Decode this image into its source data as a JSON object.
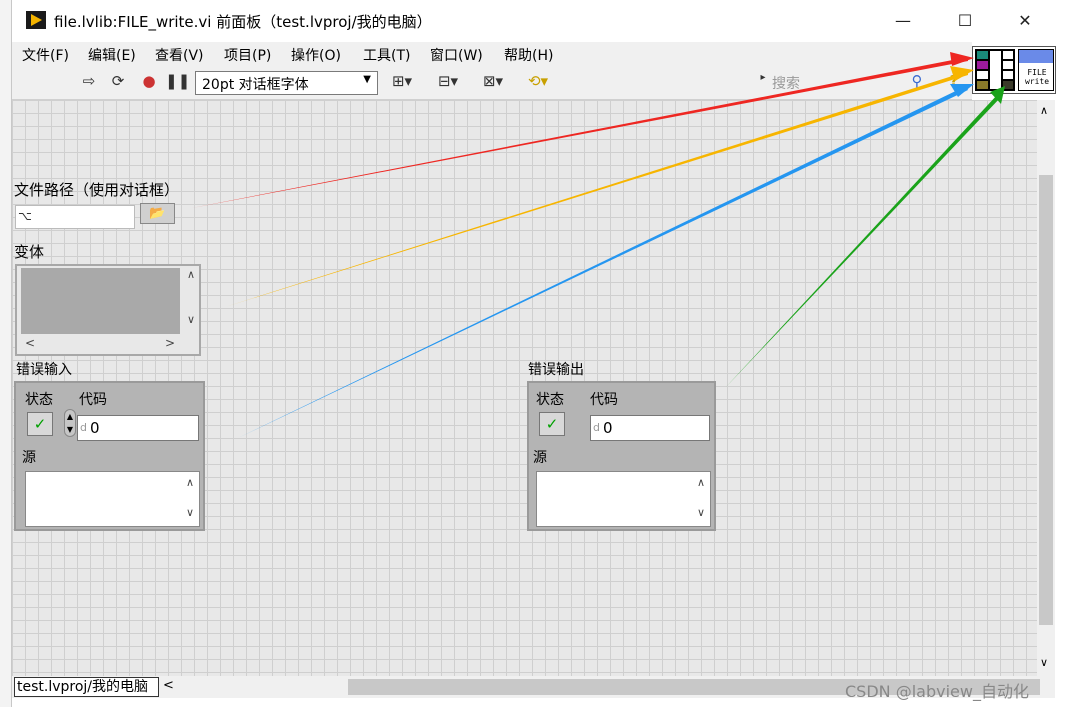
{
  "window": {
    "title": "file.lvlib:FILE_write.vi 前面板（test.lvproj/我的电脑）",
    "minimize": "—",
    "maximize": "☐",
    "close": "✕"
  },
  "menu": {
    "file": "文件(F)",
    "edit": "编辑(E)",
    "view": "查看(V)",
    "project": "项目(P)",
    "operate": "操作(O)",
    "tools": "工具(T)",
    "window": "窗口(W)",
    "help": "帮助(H)"
  },
  "toolbar": {
    "font": "20pt 对话框字体",
    "search_placeholder": "搜索",
    "help_glyph": "?"
  },
  "icon": {
    "line1": "FILE",
    "line2": "write"
  },
  "front_panel": {
    "file_path_label": "文件路径（使用对话框）",
    "file_path_value": "",
    "variant_label": "变体",
    "error_in": {
      "label": "错误输入",
      "status_label": "状态",
      "code_label": "代码",
      "code_value": "0",
      "source_label": "源"
    },
    "error_out": {
      "label": "错误输出",
      "status_label": "状态",
      "code_label": "代码",
      "code_value": "0",
      "source_label": "源"
    }
  },
  "status": {
    "project_context": "test.lvproj/我的电脑"
  },
  "watermark": "CSDN @labview_自动化",
  "colors": {
    "arrow_red": "#ee2722",
    "arrow_yellow": "#f7b500",
    "arrow_blue": "#2596f0",
    "arrow_green": "#1aa31a",
    "canvas_bg": "#e8e8e8",
    "cluster_bg": "#b4b4b4"
  }
}
